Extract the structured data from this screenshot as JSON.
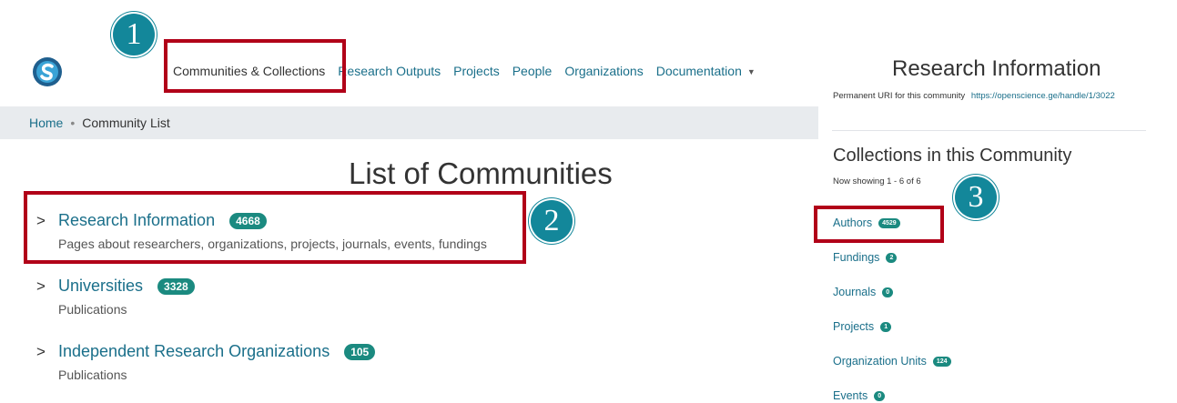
{
  "nav": {
    "items": [
      {
        "label": "Communities & Collections"
      },
      {
        "label": "Research Outputs"
      },
      {
        "label": "Projects"
      },
      {
        "label": "People"
      },
      {
        "label": "Organizations"
      },
      {
        "label": "Documentation"
      }
    ]
  },
  "breadcrumb": {
    "home": "Home",
    "separator": "•",
    "current": "Community List"
  },
  "page_title": "List of Communities",
  "communities": [
    {
      "name": "Research Information",
      "count": "4668",
      "description": "Pages about researchers, organizations, projects, journals, events, fundings"
    },
    {
      "name": "Universities",
      "count": "3328",
      "description": "Publications"
    },
    {
      "name": "Independent Research Organizations",
      "count": "105",
      "description": "Publications"
    }
  ],
  "right_panel": {
    "title": "Research Information",
    "uri_label": "Permanent URI for this community",
    "uri": "https://openscience.ge/handle/1/3022",
    "collections_heading": "Collections in this Community",
    "showing": "Now showing 1 - 6 of 6",
    "collections": [
      {
        "name": "Authors",
        "count": "4529"
      },
      {
        "name": "Fundings",
        "count": "2"
      },
      {
        "name": "Journals",
        "count": "0"
      },
      {
        "name": "Projects",
        "count": "1"
      },
      {
        "name": "Organization Units",
        "count": "124"
      },
      {
        "name": "Events",
        "count": "0"
      }
    ]
  },
  "annotations": {
    "step1": "1",
    "step2": "2",
    "step3": "3"
  },
  "colors": {
    "link": "#1a6f8a",
    "badge": "#1b8a80",
    "annotation_box": "#b10018",
    "annotation_circle": "#13879a"
  }
}
